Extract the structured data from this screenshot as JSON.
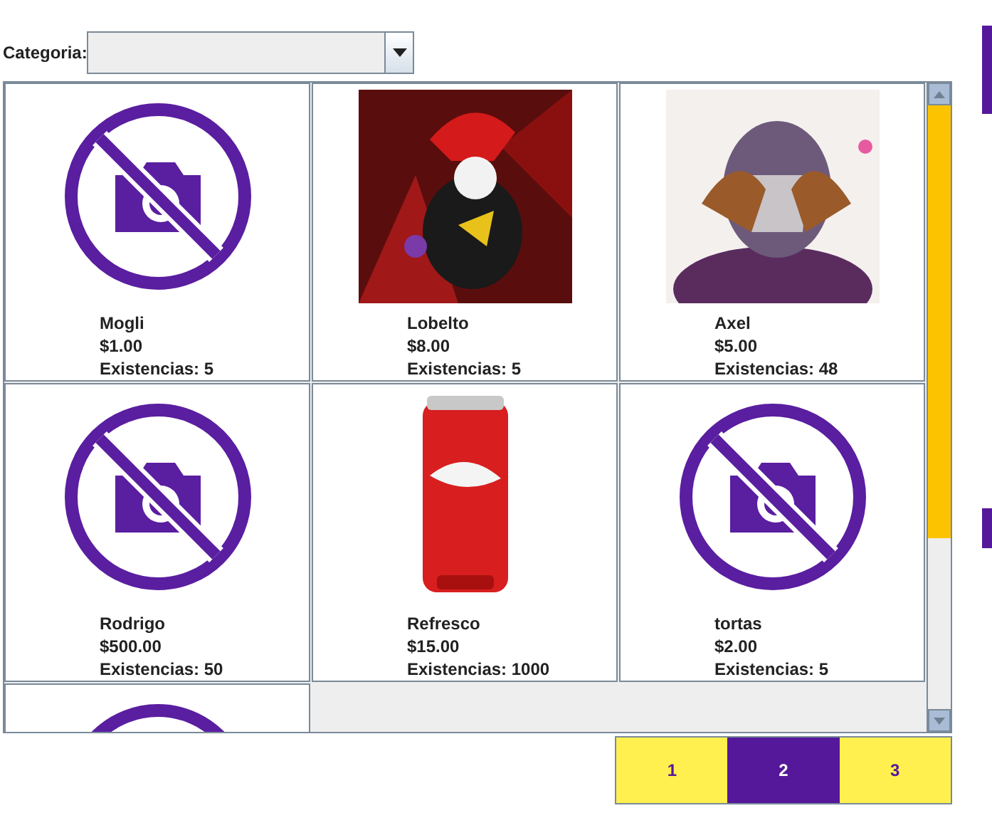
{
  "filter": {
    "label": "Categoria:"
  },
  "products": [
    {
      "kind": "no-photo",
      "name": "Mogli",
      "price": "$1.00",
      "stock": "Existencias: 5"
    },
    {
      "kind": "picture",
      "name": "Lobelto",
      "price": "$8.00",
      "stock": "Existencias: 5"
    },
    {
      "kind": "picture",
      "name": "Axel",
      "price": "$5.00",
      "stock": "Existencias: 48"
    },
    {
      "kind": "no-photo",
      "name": "Rodrigo",
      "price": "$500.00",
      "stock": "Existencias: 50"
    },
    {
      "kind": "picture",
      "name": "Refresco",
      "price": "$15.00",
      "stock": "Existencias: 1000"
    },
    {
      "kind": "no-photo",
      "name": "tortas",
      "price": "$2.00",
      "stock": "Existencias: 5"
    },
    {
      "kind": "no-photo"
    }
  ],
  "pages": [
    {
      "label": "1",
      "selected": false
    },
    {
      "label": "2",
      "selected": true
    },
    {
      "label": "3",
      "selected": false
    }
  ]
}
